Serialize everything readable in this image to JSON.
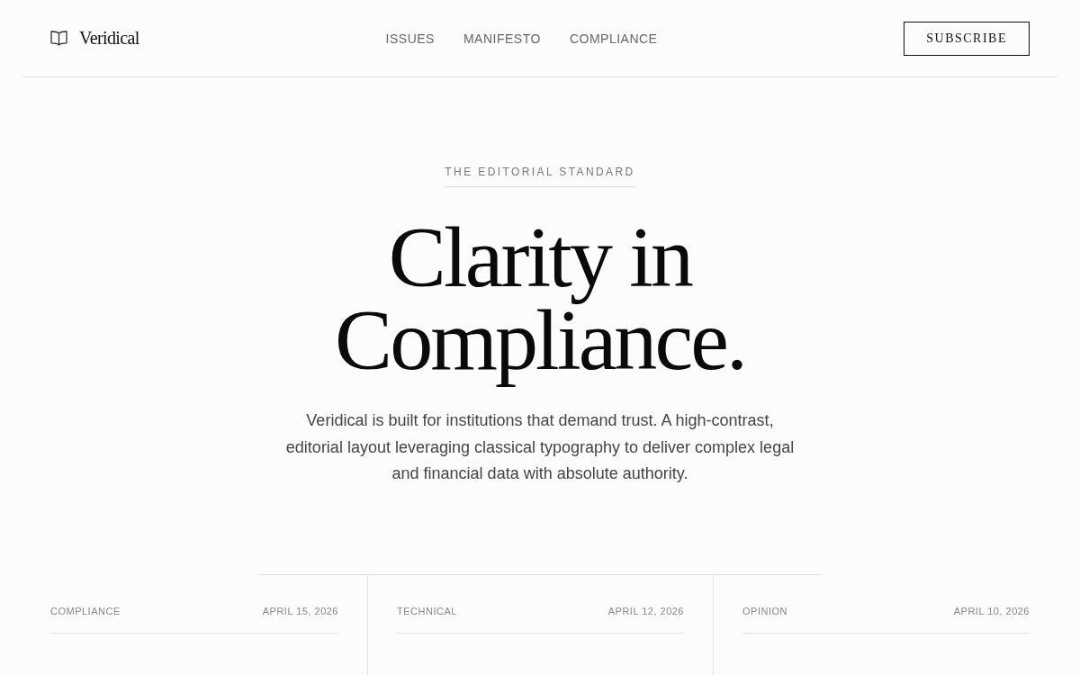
{
  "header": {
    "brand": "Veridical",
    "nav": [
      {
        "label": "ISSUES"
      },
      {
        "label": "MANIFESTO"
      },
      {
        "label": "COMPLIANCE"
      }
    ],
    "subscribe_button": "SUBSCRIBE"
  },
  "hero": {
    "eyebrow": "THE EDITORIAL STANDARD",
    "headline": "Clarity in Compliance.",
    "description": "Veridical is built for institutions that demand trust. A high-contrast, editorial layout leveraging classical typography to deliver complex legal and financial data with absolute authority."
  },
  "articles": [
    {
      "category": "COMPLIANCE",
      "date": "APRIL 15, 2026"
    },
    {
      "category": "TECHNICAL",
      "date": "APRIL 12, 2026"
    },
    {
      "category": "OPINION",
      "date": "APRIL 10, 2026"
    }
  ]
}
